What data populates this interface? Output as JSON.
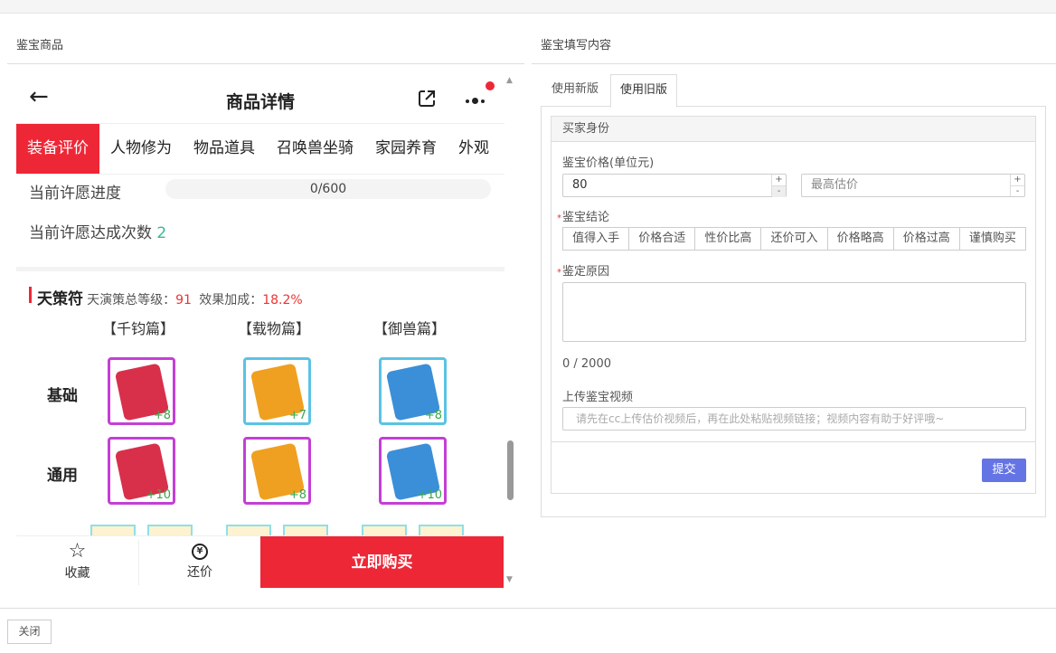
{
  "left": {
    "title": "鉴宝商品",
    "nav": {
      "title": "商品详情"
    },
    "tabs": [
      "装备评价",
      "人物修为",
      "物品道具",
      "召唤兽坐骑",
      "家园养育",
      "外观"
    ],
    "wish_progress_label": "当前许愿进度",
    "wish_progress": "0/600",
    "wish_count_label": "当前许愿达成次数",
    "wish_count": "2",
    "section": {
      "name": "天策符",
      "level_label": "天演策总等级：",
      "level": "91",
      "bonus_label": "效果加成：",
      "bonus": "18.2%"
    },
    "columns": [
      "【千钧篇】",
      "【载物篇】",
      "【御兽篇】"
    ],
    "rows": [
      {
        "label": "基础",
        "items": [
          "+8",
          "+7",
          "+8"
        ]
      },
      {
        "label": "通用",
        "items": [
          "+10",
          "+8",
          "+10"
        ]
      }
    ],
    "bottom": {
      "favorite": "收藏",
      "bargain": "还价",
      "buy": "立即购买"
    }
  },
  "right": {
    "title": "鉴宝填写内容",
    "tabs": [
      "使用新版",
      "使用旧版"
    ],
    "panel_title": "买家身份",
    "price_label": "鉴宝价格(单位元)",
    "price_value": "80",
    "max_placeholder": "最高估价",
    "conclusion_label": "鉴宝结论",
    "conclusions": [
      "值得入手",
      "价格合适",
      "性价比高",
      "还价可入",
      "价格略高",
      "价格过高",
      "谨慎购买"
    ],
    "reason_label": "鉴定原因",
    "counter": "0 / 2000",
    "video_label": "上传鉴宝视频",
    "video_placeholder": "请先在cc上传估价视频后，再在此处粘贴视频链接；视频内容有助于好评哦~",
    "submit": "提交"
  },
  "footer": {
    "close": "关闭"
  },
  "colors": {
    "accent": "#ee2737",
    "submit": "#6474e5",
    "green": "#3aa84b"
  }
}
